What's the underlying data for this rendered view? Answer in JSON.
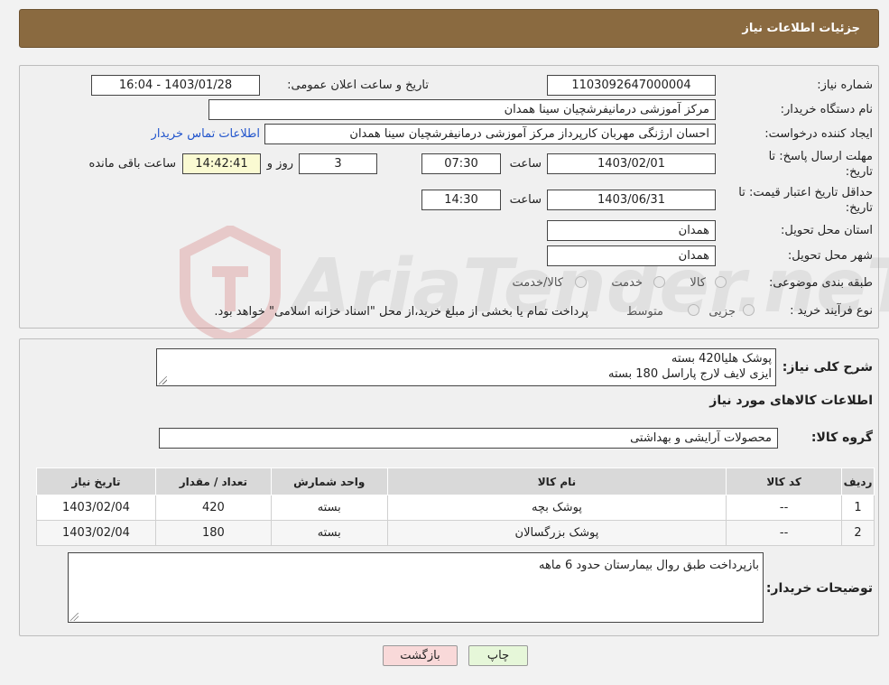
{
  "header": {
    "title": "جزئیات اطلاعات نیاز"
  },
  "form": {
    "need_number_label": "شماره نیاز:",
    "need_number": "1103092647000004",
    "announce_label": "تاریخ و ساعت اعلان عمومی:",
    "announce_value": "1403/01/28 - 16:04",
    "buyer_org_label": "نام دستگاه خریدار:",
    "buyer_org": "مرکز آموزشی درمانیفرشچیان سینا همدان",
    "creator_label": "ایجاد کننده درخواست:",
    "creator": "احسان ارژنگی مهربان کارپرداز مرکز آموزشی درمانیفرشچیان سینا همدان",
    "contact_link": "اطلاعات تماس خریدار",
    "deadline_label_1": "مهلت ارسال پاسخ: تا",
    "deadline_label_2": "تاریخ:",
    "deadline_date": "1403/02/01",
    "time_label": "ساعت",
    "deadline_time": "07:30",
    "days_value": "3",
    "days_label": "روز و",
    "remaining_time": "14:42:41",
    "remaining_label": "ساعت باقی مانده",
    "validity_label_1": "حداقل تاریخ اعتبار قیمت: تا",
    "validity_label_2": "تاریخ:",
    "validity_date": "1403/06/31",
    "validity_time": "14:30",
    "province_label": "استان محل تحویل:",
    "province": "همدان",
    "city_label": "شهر محل تحویل:",
    "city": "همدان",
    "category_label": "طبقه بندی موضوعی:",
    "category_options": [
      "کالا",
      "خدمت",
      "کالا/خدمت"
    ],
    "process_label": "نوع فرآیند خرید :",
    "process_options": [
      "جزیی",
      "متوسط"
    ],
    "process_note": "پرداخت تمام یا بخشی از مبلغ خرید،از محل \"اسناد خزانه اسلامی\" خواهد بود."
  },
  "details": {
    "summary_label": "شرح کلی نیاز:",
    "summary_line1": "پوشک هلیا420 بسته",
    "summary_line2": "ایزی لایف لارج پاراسل 180 بسته",
    "goods_info_title": "اطلاعات کالاهای مورد نیاز",
    "goods_group_label": "گروه کالا:",
    "goods_group": "محصولات آرایشی و بهداشتی",
    "table": {
      "headers": [
        "ردیف",
        "کد کالا",
        "نام کالا",
        "واحد شمارش",
        "تعداد / مقدار",
        "تاریخ نیاز"
      ],
      "rows": [
        [
          "1",
          "--",
          "پوشک بچه",
          "بسته",
          "420",
          "1403/02/04"
        ],
        [
          "2",
          "--",
          "پوشک بزرگسالان",
          "بسته",
          "180",
          "1403/02/04"
        ]
      ]
    },
    "buyer_notes_label": "توضیحات خریدار:",
    "buyer_notes": "بازپرداخت طبق روال بیمارستان حدود 6 ماهه"
  },
  "buttons": {
    "print": "چاپ",
    "back": "بازگشت"
  },
  "watermark": {
    "text": "AriaTender.neT"
  }
}
